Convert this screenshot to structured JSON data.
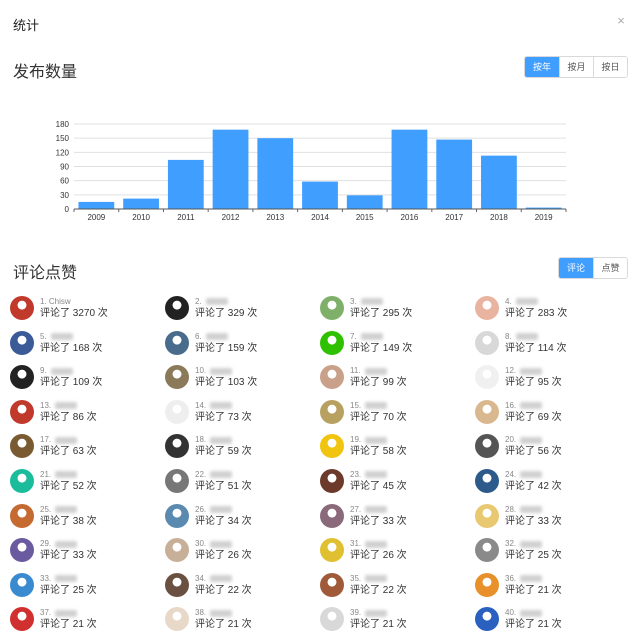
{
  "dialog": {
    "title": "统计",
    "close": "×"
  },
  "publish": {
    "title": "发布数量",
    "periods": [
      {
        "label": "按年",
        "active": true
      },
      {
        "label": "按月",
        "active": false
      },
      {
        "label": "按日",
        "active": false
      }
    ]
  },
  "chart_data": {
    "type": "bar",
    "categories": [
      "2009",
      "2010",
      "2011",
      "2012",
      "2013",
      "2014",
      "2015",
      "2016",
      "2017",
      "2018",
      "2019"
    ],
    "values": [
      15,
      22,
      104,
      168,
      150,
      58,
      29,
      168,
      147,
      113,
      3
    ],
    "ylim": [
      0,
      180
    ],
    "yticks": [
      0,
      30,
      60,
      90,
      120,
      150,
      180
    ],
    "grid": true,
    "color": "#409eff"
  },
  "comments": {
    "title": "评论点赞",
    "tabs": [
      {
        "label": "评论",
        "active": true
      },
      {
        "label": "点赞",
        "active": false
      }
    ],
    "users": [
      {
        "rank": "1.",
        "name": "Chisw",
        "count": "评论了 3270 次",
        "avatar": "#c0392b"
      },
      {
        "rank": "2.",
        "name": "",
        "count": "评论了 329 次",
        "avatar": "#222222"
      },
      {
        "rank": "3.",
        "name": "",
        "count": "评论了 295 次",
        "avatar": "#7fb069"
      },
      {
        "rank": "4.",
        "name": "",
        "count": "评论了 283 次",
        "avatar": "#e8b4a0"
      },
      {
        "rank": "5.",
        "name": "",
        "count": "评论了 168 次",
        "avatar": "#3a5a98"
      },
      {
        "rank": "6.",
        "name": "",
        "count": "评论了 159 次",
        "avatar": "#4a6c8c"
      },
      {
        "rank": "7.",
        "name": "",
        "count": "评论了 149 次",
        "avatar": "#2dc100"
      },
      {
        "rank": "8.",
        "name": "",
        "count": "评论了 114 次",
        "avatar": "#d8d8d8"
      },
      {
        "rank": "9.",
        "name": "",
        "count": "评论了 109 次",
        "avatar": "#222222"
      },
      {
        "rank": "10.",
        "name": "",
        "count": "评论了 103 次",
        "avatar": "#8a7a5a"
      },
      {
        "rank": "11.",
        "name": "",
        "count": "评论了 99 次",
        "avatar": "#c9a08a"
      },
      {
        "rank": "12.",
        "name": "",
        "count": "评论了 95 次",
        "avatar": "#f0f0f0"
      },
      {
        "rank": "13.",
        "name": "",
        "count": "评论了 86 次",
        "avatar": "#c0392b"
      },
      {
        "rank": "14.",
        "name": "",
        "count": "评论了 73 次",
        "avatar": "#eeeeee"
      },
      {
        "rank": "15.",
        "name": "",
        "count": "评论了 70 次",
        "avatar": "#b8a060"
      },
      {
        "rank": "16.",
        "name": "",
        "count": "评论了 69 次",
        "avatar": "#d9b890"
      },
      {
        "rank": "17.",
        "name": "",
        "count": "评论了 63 次",
        "avatar": "#7a5a30"
      },
      {
        "rank": "18.",
        "name": "",
        "count": "评论了 59 次",
        "avatar": "#333333"
      },
      {
        "rank": "19.",
        "name": "",
        "count": "评论了 58 次",
        "avatar": "#f1c40f"
      },
      {
        "rank": "20.",
        "name": "",
        "count": "评论了 56 次",
        "avatar": "#555555"
      },
      {
        "rank": "21.",
        "name": "",
        "count": "评论了 52 次",
        "avatar": "#1abc9c"
      },
      {
        "rank": "22.",
        "name": "",
        "count": "评论了 51 次",
        "avatar": "#777777"
      },
      {
        "rank": "23.",
        "name": "",
        "count": "评论了 45 次",
        "avatar": "#6b3a2a"
      },
      {
        "rank": "24.",
        "name": "",
        "count": "评论了 42 次",
        "avatar": "#2c5a8a"
      },
      {
        "rank": "25.",
        "name": "",
        "count": "评论了 38 次",
        "avatar": "#c56a30"
      },
      {
        "rank": "26.",
        "name": "",
        "count": "评论了 34 次",
        "avatar": "#5a8ab0"
      },
      {
        "rank": "27.",
        "name": "",
        "count": "评论了 33 次",
        "avatar": "#8a6a7a"
      },
      {
        "rank": "28.",
        "name": "",
        "count": "评论了 33 次",
        "avatar": "#e8c870"
      },
      {
        "rank": "29.",
        "name": "",
        "count": "评论了 33 次",
        "avatar": "#6a5aa0"
      },
      {
        "rank": "30.",
        "name": "",
        "count": "评论了 26 次",
        "avatar": "#c8b098"
      },
      {
        "rank": "31.",
        "name": "",
        "count": "评论了 26 次",
        "avatar": "#e0c030"
      },
      {
        "rank": "32.",
        "name": "",
        "count": "评论了 25 次",
        "avatar": "#8a8a8a"
      },
      {
        "rank": "33.",
        "name": "",
        "count": "评论了 25 次",
        "avatar": "#3a8ad0"
      },
      {
        "rank": "34.",
        "name": "",
        "count": "评论了 22 次",
        "avatar": "#6a5040"
      },
      {
        "rank": "35.",
        "name": "",
        "count": "评论了 22 次",
        "avatar": "#a05a3a"
      },
      {
        "rank": "36.",
        "name": "",
        "count": "评论了 21 次",
        "avatar": "#e8902a"
      },
      {
        "rank": "37.",
        "name": "",
        "count": "评论了 21 次",
        "avatar": "#d03030"
      },
      {
        "rank": "38.",
        "name": "",
        "count": "评论了 21 次",
        "avatar": "#e8d8c8"
      },
      {
        "rank": "39.",
        "name": "",
        "count": "评论了 21 次",
        "avatar": "#d8d8d8"
      },
      {
        "rank": "40.",
        "name": "",
        "count": "评论了 21 次",
        "avatar": "#2a60c0"
      }
    ]
  }
}
